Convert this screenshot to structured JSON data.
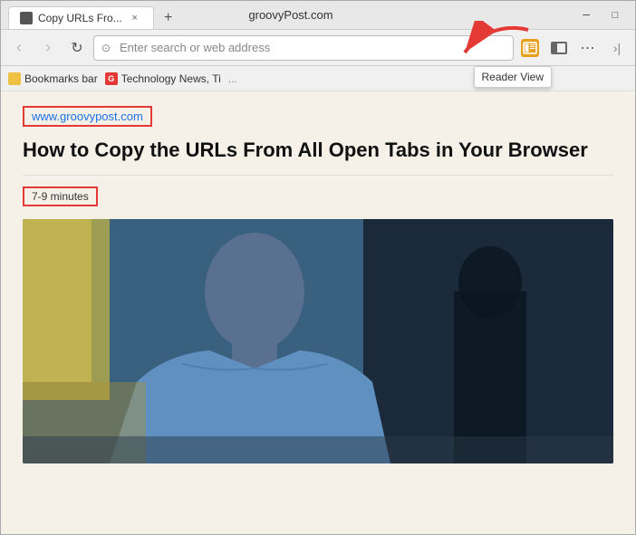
{
  "browser": {
    "title": "groovyPost.com",
    "tab": {
      "label": "Copy URLs Fro...",
      "close": "×"
    },
    "new_tab": "+",
    "window_controls": {
      "minimize": "─",
      "maximize": "□",
      "close": "×"
    }
  },
  "navbar": {
    "back": "‹",
    "forward": "›",
    "refresh": "↻",
    "home": "⌂",
    "address_placeholder": "Enter search or web address",
    "reader_view_label": "Reader View",
    "sidebar_label": "Sidebar",
    "more_label": "⋯"
  },
  "bookmarks": {
    "bar_label": "Bookmarks bar",
    "items": [
      {
        "label": "Technology News, Ti",
        "icon_type": "g"
      }
    ]
  },
  "content": {
    "site_url": "www.groovypost.com",
    "article_title": "How to Copy the URLs From All Open Tabs in Your Browser",
    "read_time": "7-9 minutes"
  }
}
